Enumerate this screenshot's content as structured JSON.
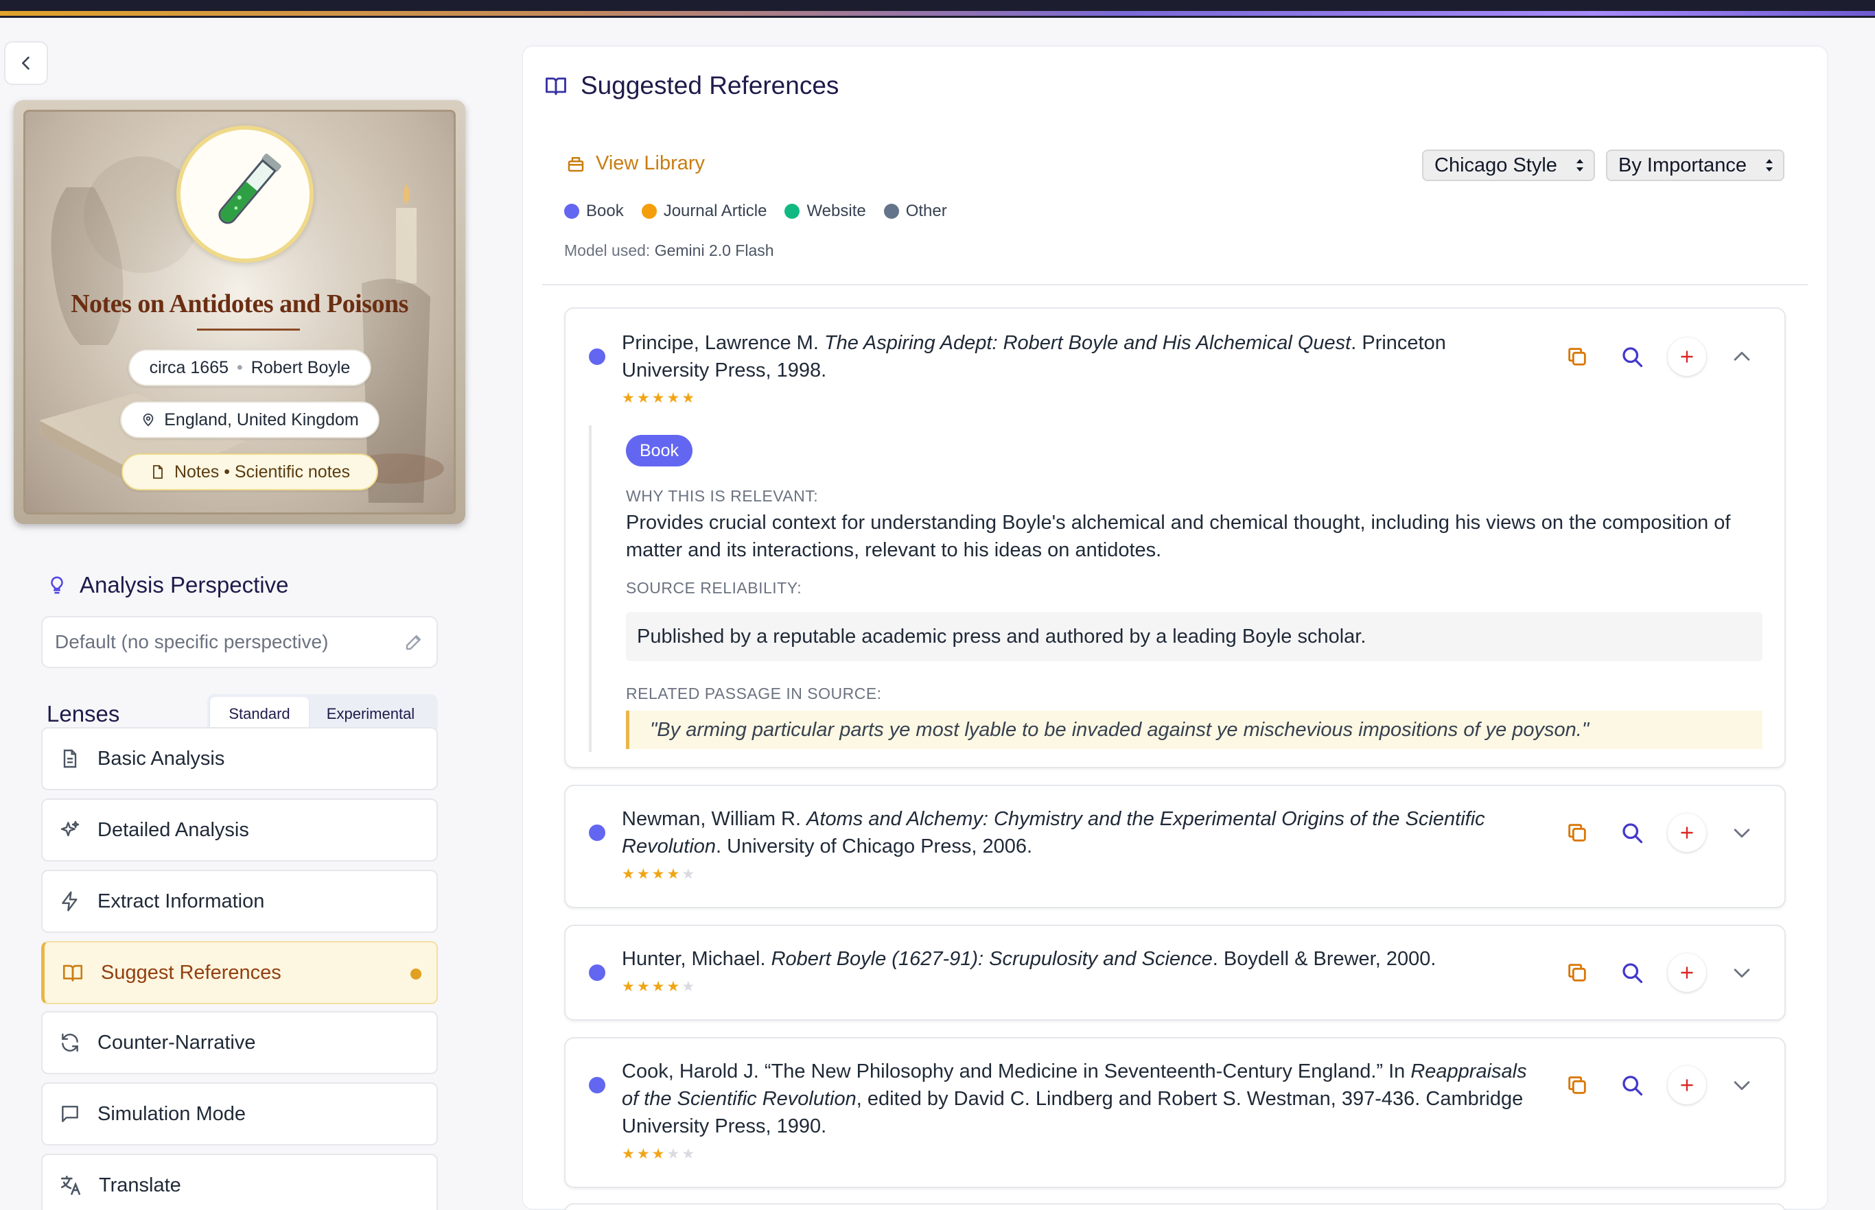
{
  "sidebar": {
    "card": {
      "title": "Notes on Antidotes and Poisons",
      "date": "circa 1665",
      "author": "Robert Boyle",
      "location": "England, United Kingdom",
      "doc_type": "Notes • Scientific notes"
    },
    "perspective": {
      "title": "Analysis Perspective",
      "value": "Default (no specific perspective)"
    },
    "lenses": {
      "title": "Lenses",
      "toggle": [
        "Standard",
        "Experimental"
      ],
      "items": [
        {
          "label": "Basic Analysis",
          "icon": "document-icon"
        },
        {
          "label": "Detailed Analysis",
          "icon": "sparkles-icon"
        },
        {
          "label": "Extract Information",
          "icon": "lightning-icon"
        },
        {
          "label": "Suggest References",
          "icon": "book-icon",
          "active": true
        },
        {
          "label": "Counter-Narrative",
          "icon": "refresh-icon"
        },
        {
          "label": "Simulation Mode",
          "icon": "chat-icon"
        },
        {
          "label": "Translate",
          "icon": "translate-icon"
        }
      ]
    }
  },
  "main": {
    "title": "Suggested References",
    "view_library": "View Library",
    "citation_style": "Chicago Style",
    "sort_by": "By Importance",
    "legend": [
      {
        "label": "Book",
        "color": "#6366f1"
      },
      {
        "label": "Journal Article",
        "color": "#f59e0b"
      },
      {
        "label": "Website",
        "color": "#10b981"
      },
      {
        "label": "Other",
        "color": "#64748b"
      }
    ],
    "model_label": "Model used:",
    "model_value": "Gemini 2.0 Flash",
    "references": [
      {
        "pre": "Principe, Lawrence M. ",
        "title": "The Aspiring Adept: Robert Boyle and His Alchemical Quest",
        "post": ". Princeton University Press, 1998.",
        "rating": 5,
        "expanded": true,
        "type": "Book",
        "why_label": "WHY THIS IS RELEVANT:",
        "why": "Provides crucial context for understanding Boyle's alchemical and chemical thought, including his views on the composition of matter and its interactions, relevant to his ideas on antidotes.",
        "reliability_label": "SOURCE RELIABILITY:",
        "reliability": "Published by a reputable academic press and authored by a leading Boyle scholar.",
        "passage_label": "RELATED PASSAGE IN SOURCE:",
        "passage": "\"By arming particular parts ye most lyable to be invaded against ye mischevious impositions of ye poyson.\""
      },
      {
        "pre": "Newman, William R. ",
        "title": "Atoms and Alchemy: Chymistry and the Experimental Origins of the Scientific Revolution",
        "post": ". University of Chicago Press, 2006.",
        "rating": 4
      },
      {
        "pre": "Hunter, Michael. ",
        "title": "Robert Boyle (1627-91): Scrupulosity and Science",
        "post": ". Boydell & Brewer, 2000.",
        "rating": 4
      },
      {
        "pre": "Cook, Harold J. “The New Philosophy and Medicine in Seventeenth-Century England.” In ",
        "title": "Reappraisals of the Scientific Revolution",
        "post": ", edited by David C. Lindberg and Robert S. Westman, 397-436. Cambridge University Press, 1990.",
        "rating": 3
      }
    ],
    "colors": {
      "accent": "#6366f1",
      "brand": "#c97d10",
      "plus": "#dc2626"
    }
  }
}
